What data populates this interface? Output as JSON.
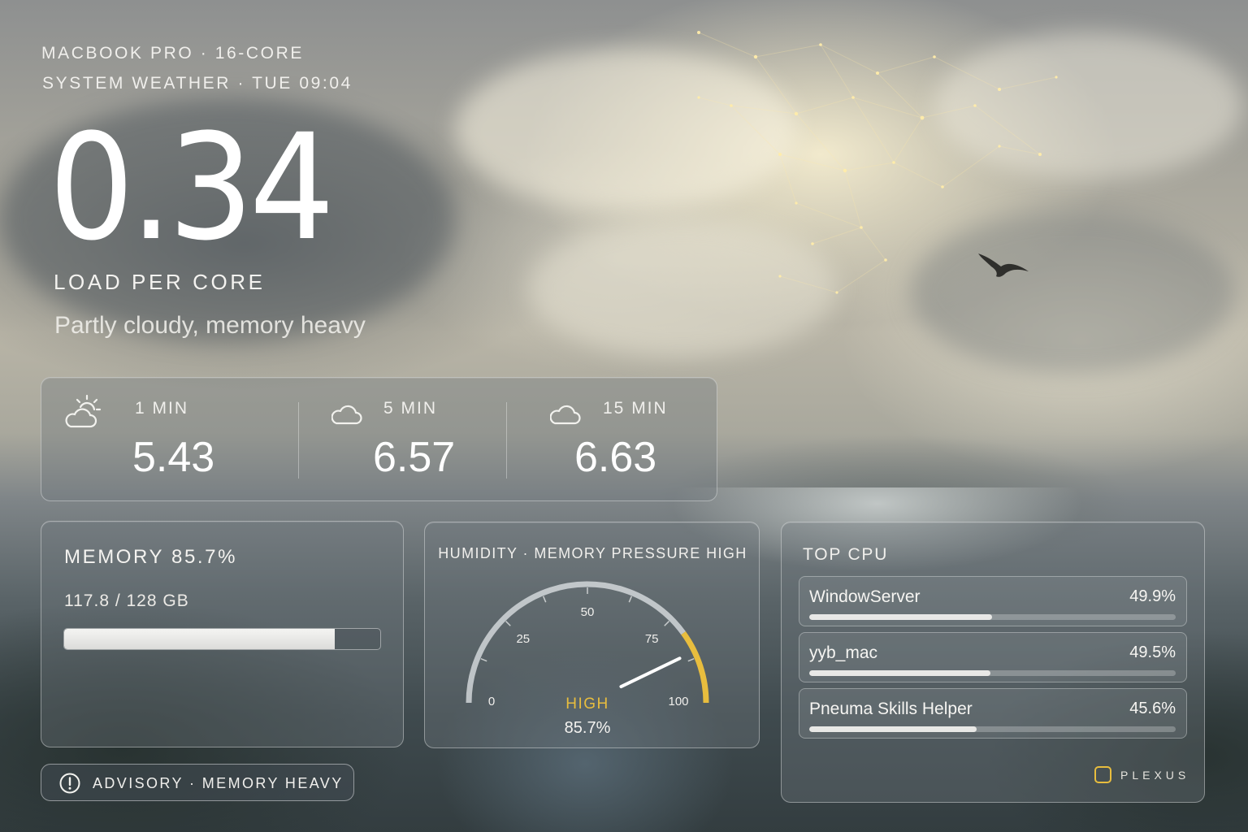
{
  "header": {
    "device": "MACBOOK PRO · 16-CORE",
    "subtitle": "SYSTEM WEATHER · TUE 09:04"
  },
  "hero": {
    "value": "0.34",
    "label": "LOAD PER CORE",
    "condition": "Partly cloudy, memory heavy"
  },
  "load_averages": [
    {
      "label": "1 MIN",
      "value": "5.43",
      "icon": "partly-sunny-icon"
    },
    {
      "label": "5 MIN",
      "value": "6.57",
      "icon": "cloud-icon"
    },
    {
      "label": "15 MIN",
      "value": "6.63",
      "icon": "cloud-icon"
    }
  ],
  "memory": {
    "title": "MEMORY 85.7%",
    "used_total": "117.8 / 128 GB",
    "fraction": 0.857
  },
  "humidity": {
    "title": "HUMIDITY · MEMORY PRESSURE HIGH",
    "ticks": [
      "0",
      "25",
      "50",
      "75",
      "100"
    ],
    "status": "HIGH",
    "value_text": "85.7%",
    "value": 85.7,
    "accent": "#e8bd3e"
  },
  "top_cpu": {
    "title": "TOP CPU",
    "processes": [
      {
        "name": "WindowServer",
        "pct": "49.9%",
        "value": 49.9
      },
      {
        "name": "yyb_mac",
        "pct": "49.5%",
        "value": 49.5
      },
      {
        "name": "Pneuma Skills Helper",
        "pct": "45.6%",
        "value": 45.6
      }
    ]
  },
  "brand": {
    "name": "PLEXUS",
    "color": "#e8bd3e"
  },
  "advisory": {
    "text": "ADVISORY · MEMORY HEAVY",
    "icon": "alert-circle-icon"
  }
}
